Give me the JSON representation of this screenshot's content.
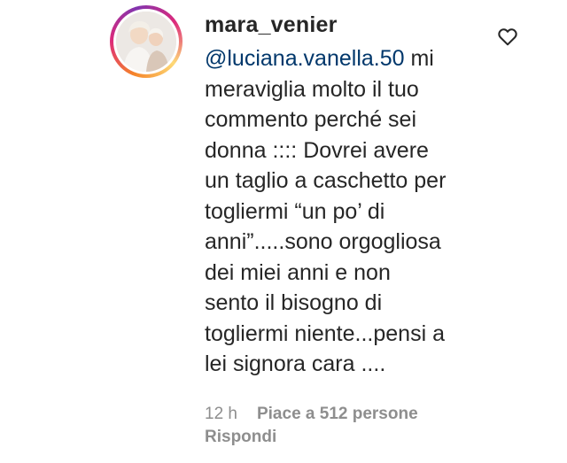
{
  "comment": {
    "username": "mara_venier",
    "mention": "@luciana.vanella.50",
    "text": " mi\nmeraviglia molto il tuo\ncommento perché sei\ndonna :::: Dovrei avere\nun taglio a caschetto per\ntogliermi “un po’ di\nanni”.....sono orgogliosa\ndei miei anni e non\nsento il bisogno di\ntogliermi niente...pensi a\nlei signora cara ....",
    "time": "12 h",
    "likes": "Piace a 512 persone",
    "reply_label": "Rispondi",
    "like_icon": "heart-outline-icon",
    "colors": {
      "text": "#262626",
      "mention": "#00376b",
      "meta": "#8e8e8e"
    }
  }
}
